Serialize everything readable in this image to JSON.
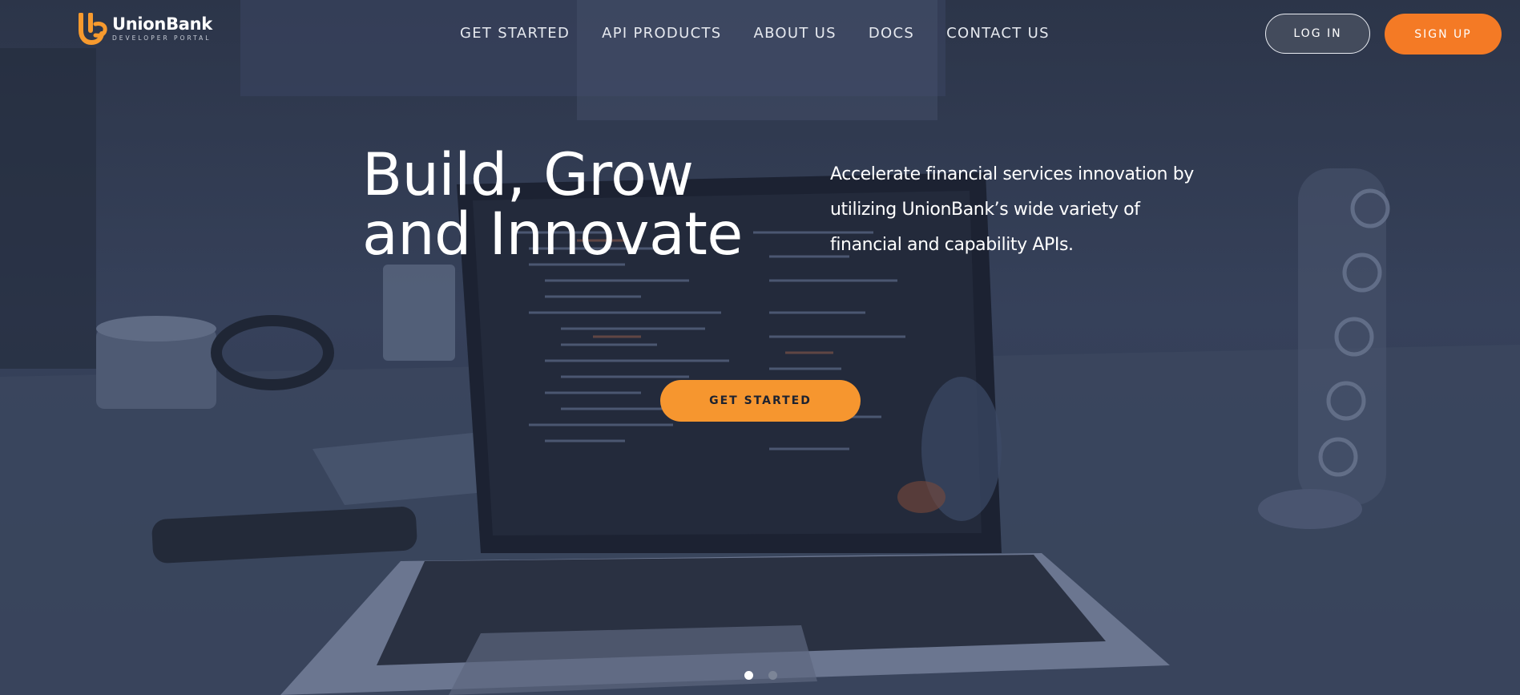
{
  "brand": {
    "name": "UnionBank",
    "subtitle": "DEVELOPER PORTAL",
    "logo_icon": "unionbank-ub-logo-icon",
    "accent_color": "#f47a25"
  },
  "nav": {
    "items": [
      {
        "label": "GET STARTED"
      },
      {
        "label": "API PRODUCTS"
      },
      {
        "label": "ABOUT US"
      },
      {
        "label": "DOCS"
      },
      {
        "label": "CONTACT US"
      }
    ]
  },
  "auth": {
    "login_label": "LOG IN",
    "signup_label": "SIGN UP"
  },
  "hero": {
    "headline_line1": "Build, Grow",
    "headline_line2": "and Innovate",
    "description": "Accelerate financial services innovation by utilizing UnionBank’s wide variety of financial and capability APIs.",
    "cta_label": "GET STARTED",
    "cta_color": "#f6962f"
  },
  "carousel": {
    "slide_count": 2,
    "active_slide": 1
  }
}
